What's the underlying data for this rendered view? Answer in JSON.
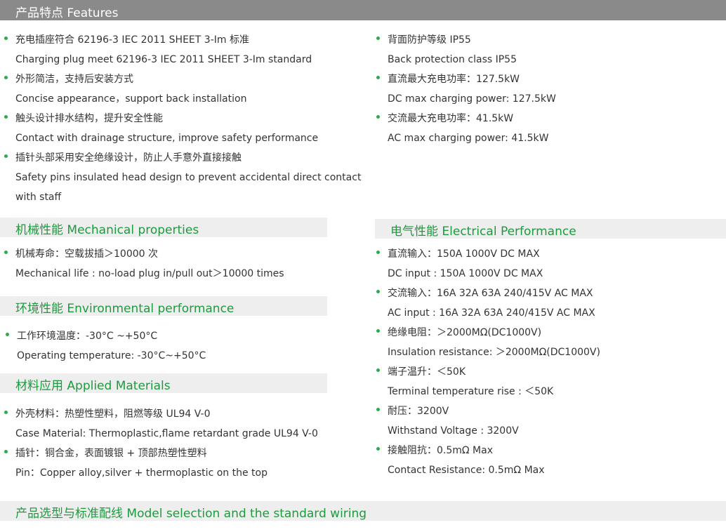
{
  "features": {
    "title": "产品特点 Features",
    "left": [
      {
        "cn": "充电插座符合 62196-3 IEC 2011 SHEET 3-Im 标准",
        "en": [
          "Charging plug meet 62196-3 IEC 2011 SHEET 3-Im standard"
        ]
      },
      {
        "cn": "外形简洁，支持后安装方式",
        "en": [
          "Concise appearance，support back installation"
        ]
      },
      {
        "cn": "触头设计排水结构，提升安全性能",
        "en": [
          "Contact with drainage structure, improve safety performance"
        ]
      },
      {
        "cn": "插针头部采用安全绝缘设计，防止人手意外直接接触",
        "en": [
          "Safety pins insulated head design to prevent accidental direct contact",
          "with staff"
        ]
      }
    ],
    "right": [
      {
        "cn": "背面防护等级 IP55",
        "en": [
          "Back protection class IP55"
        ]
      },
      {
        "cn": "直流最大充电功率：127.5kW",
        "en": [
          "DC max charging power: 127.5kW"
        ]
      },
      {
        "cn": "交流最大充电功率：41.5kW",
        "en": [
          "AC max charging power: 41.5kW"
        ]
      }
    ]
  },
  "mechanical": {
    "title": "机械性能 Mechanical properties",
    "items": [
      {
        "cn": "机械寿命：空载拔插＞10000 次",
        "en": [
          "Mechanical life : no-load plug in/pull out＞10000 times"
        ]
      }
    ]
  },
  "environmental": {
    "title": "环境性能 Environmental performance",
    "items": [
      {
        "cn": "工作环境温度：-30°C ~+50°C",
        "en": [
          "Operating temperature: -30°C~+50°C"
        ]
      }
    ]
  },
  "materials": {
    "title": "材料应用 Applied Materials",
    "items": [
      {
        "cn": "外壳材料：热塑性塑料，阻燃等级 UL94 V-0",
        "en": [
          "Case Material: Thermoplastic,flame retardant grade UL94 V-0"
        ]
      },
      {
        "cn": "插针：铜合金，表面镀银 + 顶部热塑性塑料",
        "en": [
          "Pin：Copper alloy,silver + thermoplastic on the top"
        ]
      }
    ]
  },
  "electrical": {
    "title": "电气性能 Electrical Performance",
    "items": [
      {
        "cn": "直流输入：150A 1000V DC MAX",
        "en": [
          "DC input : 150A 1000V DC MAX"
        ]
      },
      {
        "cn": "交流输入：16A 32A 63A 240/415V AC MAX",
        "en": [
          "AC input : 16A 32A 63A 240/415V AC MAX"
        ]
      },
      {
        "cn": "绝缘电阻：＞2000MΩ(DC1000V)",
        "en": [
          "Insulation resistance: ＞2000MΩ(DC1000V)"
        ]
      },
      {
        "cn": "端子温升：＜50K",
        "en": [
          "Terminal temperature rise : ＜50K"
        ]
      },
      {
        "cn": "耐压：3200V",
        "en": [
          "Withstand Voltage : 3200V"
        ]
      },
      {
        "cn": "接触阻抗：0.5mΩ Max",
        "en": [
          "Contact Resistance: 0.5mΩ Max"
        ]
      }
    ]
  },
  "model": {
    "title": "产品选型与标准配线 Model selection and the standard wiring"
  },
  "colors": {
    "accent": "#1e9a3e",
    "bullet": "#2fa84f",
    "banner": "#8a8a8a",
    "section_bg": "#eeeeee"
  }
}
